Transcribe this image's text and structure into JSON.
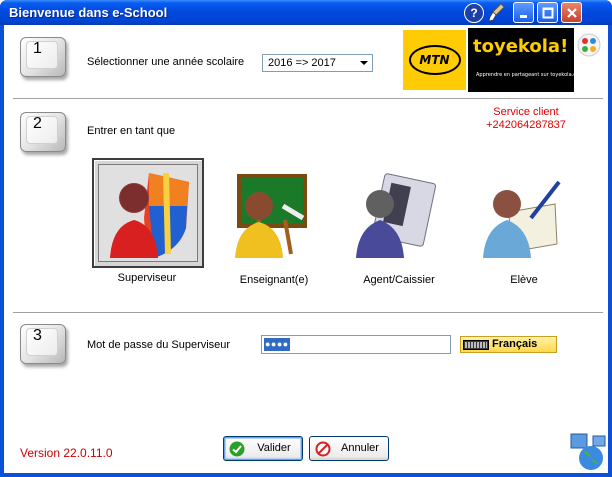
{
  "window": {
    "title": "Bienvenue dans e-School"
  },
  "step1": {
    "number": "1",
    "label": "Sélectionner une année scolaire",
    "year_selected": "2016 => 2017"
  },
  "branding": {
    "mtn_text": "MTN",
    "toyekola_text": "toyekola!",
    "toyekola_tagline": "Apprendre en partageant sur toyekola.com"
  },
  "step2": {
    "number": "2",
    "label": "Entrer en tant que",
    "roles": [
      {
        "label": "Superviseur",
        "selected": true
      },
      {
        "label": "Enseignant(e)",
        "selected": false
      },
      {
        "label": "Agent/Caissier",
        "selected": false
      },
      {
        "label": "Elève",
        "selected": false
      }
    ]
  },
  "service": {
    "line1": "Service client",
    "line2": "+242064287837"
  },
  "step3": {
    "number": "3",
    "label": "Mot de passe du Superviseur",
    "password_masked": "●●●●",
    "language": "Français"
  },
  "footer": {
    "version": "Version 22.0.11.0",
    "ok_label": "Valider",
    "cancel_label": "Annuler"
  },
  "colors": {
    "titlebar": "#0048dc",
    "service_text": "#e00000",
    "version_text": "#cc0000",
    "mtn_yellow": "#ffcb05"
  }
}
